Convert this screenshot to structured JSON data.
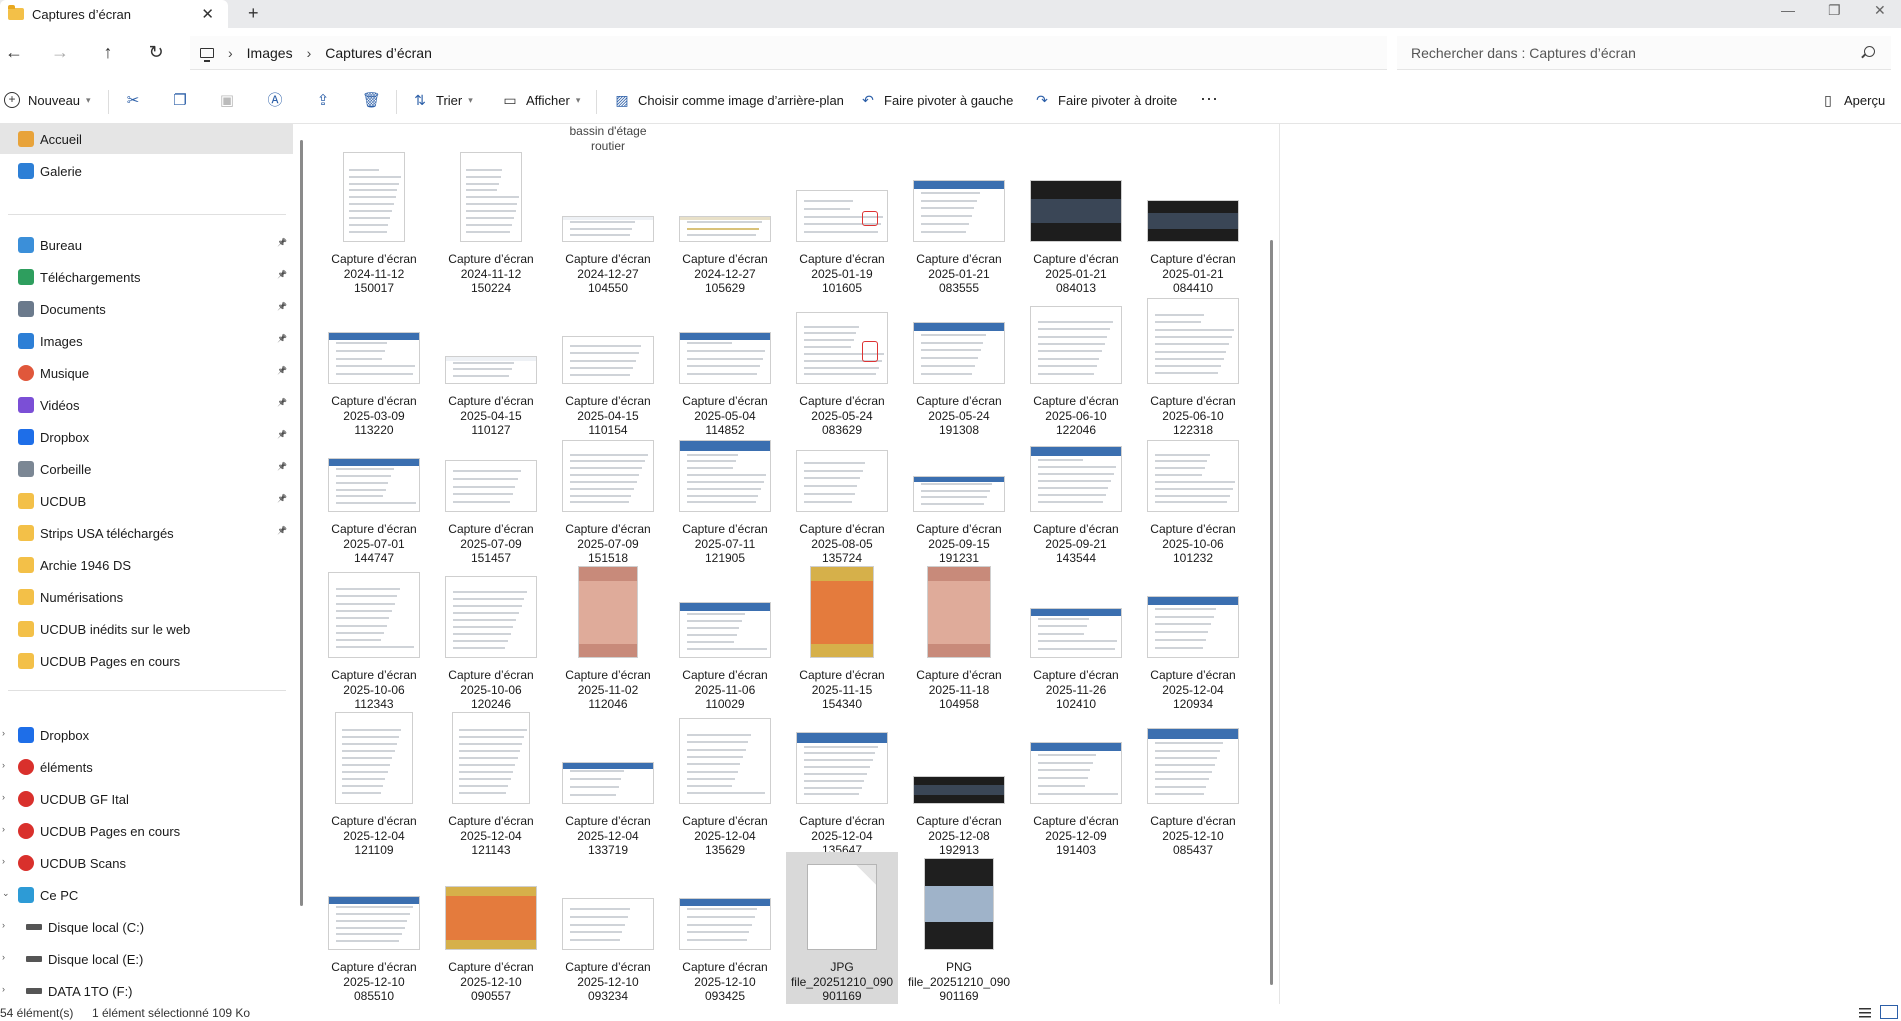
{
  "window": {
    "tab_title": "Captures d’écran",
    "close_glyph": "✕",
    "new_tab_glyph": "+",
    "minimize_glyph": "—",
    "maximize_glyph": "❐",
    "close_window_glyph": "✕"
  },
  "nav": {
    "back": "←",
    "forward": "→",
    "up": "↑",
    "refresh": "↻"
  },
  "breadcrumb": {
    "items": [
      "Images",
      "Captures d’écran"
    ],
    "sep": "›"
  },
  "search": {
    "placeholder": "Rechercher dans : Captures d’écran"
  },
  "toolbar": {
    "new_label": "Nouveau",
    "sort_label": "Trier",
    "view_label": "Afficher",
    "wallpaper_label": "Choisir comme image d’arrière-plan",
    "rotate_left_label": "Faire pivoter à gauche",
    "rotate_right_label": "Faire pivoter à droite",
    "more_label": "···",
    "preview_label": "Aperçu"
  },
  "sidebar": {
    "items": [
      {
        "label": "Accueil",
        "icon": "home-icon",
        "color": "#e8a33a"
      },
      {
        "label": "Galerie",
        "icon": "gallery-icon",
        "color": "#2d7fd6"
      },
      {
        "label": "Bureau",
        "icon": "desktop-icon",
        "color": "#3b8fd9",
        "pinned": true
      },
      {
        "label": "Téléchargements",
        "icon": "download-icon",
        "color": "#2e9e5e",
        "pinned": true
      },
      {
        "label": "Documents",
        "icon": "documents-icon",
        "color": "#6b7a8c",
        "pinned": true
      },
      {
        "label": "Images",
        "icon": "images-icon",
        "color": "#2d7fd6",
        "pinned": true
      },
      {
        "label": "Musique",
        "icon": "music-icon",
        "color": "#e0573b",
        "pinned": true
      },
      {
        "label": "Vidéos",
        "icon": "videos-icon",
        "color": "#7b4fd6",
        "pinned": true
      },
      {
        "label": "Dropbox",
        "icon": "dropbox-icon",
        "color": "#1e6ee8",
        "pinned": true
      },
      {
        "label": "Corbeille",
        "icon": "recycle-bin-icon",
        "color": "#7b8794",
        "pinned": true
      },
      {
        "label": "UCDUB",
        "icon": "folder-icon",
        "color": "#f3c048",
        "pinned": true
      },
      {
        "label": "Strips USA téléchargés",
        "icon": "folder-icon",
        "color": "#f3c048",
        "pinned": true
      },
      {
        "label": "Archie 1946 DS",
        "icon": "folder-icon",
        "color": "#f3c048"
      },
      {
        "label": "Numérisations",
        "icon": "folder-icon",
        "color": "#f3c048"
      },
      {
        "label": "UCDUB inédits sur le web",
        "icon": "folder-icon",
        "color": "#f3c048"
      },
      {
        "label": "UCDUB Pages en cours",
        "icon": "folder-icon",
        "color": "#f3c048"
      },
      {
        "label": "Dropbox",
        "icon": "dropbox-icon",
        "color": "#1e6ee8"
      },
      {
        "label": "éléments",
        "icon": "sync-folder-icon",
        "color": "#d9302c"
      },
      {
        "label": "UCDUB GF Ital",
        "icon": "sync-folder-icon",
        "color": "#d9302c"
      },
      {
        "label": "UCDUB Pages en cours",
        "icon": "sync-folder-icon",
        "color": "#d9302c"
      },
      {
        "label": "UCDUB Scans",
        "icon": "sync-folder-icon",
        "color": "#d9302c"
      },
      {
        "label": "Ce PC",
        "icon": "this-pc-icon",
        "color": "#2d9bd6"
      },
      {
        "label": "Disque local (C:)",
        "icon": "drive-icon",
        "color": "#555555"
      },
      {
        "label": "Disque local (E:)",
        "icon": "drive-icon",
        "color": "#555555"
      },
      {
        "label": "DATA 1TO (F:)",
        "icon": "drive-icon",
        "color": "#555555"
      }
    ]
  },
  "files": {
    "top_partial": [
      "bassin d'étage routier"
    ],
    "rows": [
      [
        [
          "Capture d’écran",
          "2024-11-12",
          "150017"
        ],
        [
          "Capture d’écran",
          "2024-11-12",
          "150224"
        ],
        [
          "Capture d’écran",
          "2024-12-27",
          "104550"
        ],
        [
          "Capture d’écran",
          "2024-12-27",
          "105629"
        ],
        [
          "Capture d’écran",
          "2025-01-19",
          "101605"
        ],
        [
          "Capture d’écran",
          "2025-01-21",
          "083555"
        ],
        [
          "Capture d’écran",
          "2025-01-21",
          "084013"
        ],
        [
          "Capture d’écran",
          "2025-01-21",
          "084410"
        ]
      ],
      [
        [
          "Capture d’écran",
          "2025-03-09",
          "113220"
        ],
        [
          "Capture d’écran",
          "2025-04-15",
          "110127"
        ],
        [
          "Capture d’écran",
          "2025-04-15",
          "110154"
        ],
        [
          "Capture d’écran",
          "2025-05-04",
          "114852"
        ],
        [
          "Capture d’écran",
          "2025-05-24",
          "083629"
        ],
        [
          "Capture d’écran",
          "2025-05-24",
          "191308"
        ],
        [
          "Capture d’écran",
          "2025-06-10",
          "122046"
        ],
        [
          "Capture d’écran",
          "2025-06-10",
          "122318"
        ]
      ],
      [
        [
          "Capture d’écran",
          "2025-07-01",
          "144747"
        ],
        [
          "Capture d’écran",
          "2025-07-09",
          "151457"
        ],
        [
          "Capture d’écran",
          "2025-07-09",
          "151518"
        ],
        [
          "Capture d’écran",
          "2025-07-11",
          "121905"
        ],
        [
          "Capture d’écran",
          "2025-08-05",
          "135724"
        ],
        [
          "Capture d’écran",
          "2025-09-15",
          "191231"
        ],
        [
          "Capture d’écran",
          "2025-09-21",
          "143544"
        ],
        [
          "Capture d’écran",
          "2025-10-06",
          "101232"
        ]
      ],
      [
        [
          "Capture d’écran",
          "2025-10-06",
          "112343"
        ],
        [
          "Capture d’écran",
          "2025-10-06",
          "120246"
        ],
        [
          "Capture d’écran",
          "2025-11-02",
          "112046"
        ],
        [
          "Capture d’écran",
          "2025-11-06",
          "110029"
        ],
        [
          "Capture d’écran",
          "2025-11-15",
          "154340"
        ],
        [
          "Capture d’écran",
          "2025-11-18",
          "104958"
        ],
        [
          "Capture d’écran",
          "2025-11-26",
          "102410"
        ],
        [
          "Capture d’écran",
          "2025-12-04",
          "120934"
        ]
      ],
      [
        [
          "Capture d’écran",
          "2025-12-04",
          "121109"
        ],
        [
          "Capture d’écran",
          "2025-12-04",
          "121143"
        ],
        [
          "Capture d’écran",
          "2025-12-04",
          "133719"
        ],
        [
          "Capture d’écran",
          "2025-12-04",
          "135629"
        ],
        [
          "Capture d’écran",
          "2025-12-04",
          "135647"
        ],
        [
          "Capture d’écran",
          "2025-12-08",
          "192913"
        ],
        [
          "Capture d’écran",
          "2025-12-09",
          "191403"
        ],
        [
          "Capture d’écran",
          "2025-12-10",
          "085437"
        ]
      ],
      [
        [
          "Capture d’écran",
          "2025-12-10",
          "085510"
        ],
        [
          "Capture d’écran",
          "2025-12-10",
          "090557"
        ],
        [
          "Capture d’écran",
          "2025-12-10",
          "093234"
        ],
        [
          "Capture d’écran",
          "2025-12-10",
          "093425"
        ],
        [
          "JPG",
          "file_20251210_090",
          "901169"
        ],
        [
          "PNG",
          "file_20251210_090",
          "901169"
        ]
      ]
    ],
    "selected": "JPG file_20251210_090901169"
  },
  "status": {
    "count": "54 élément(s)",
    "selection": "1 élément sélectionné  109 Ko"
  },
  "colors": {
    "accent": "#2c5fa8",
    "selection": "#d9d9d9"
  }
}
